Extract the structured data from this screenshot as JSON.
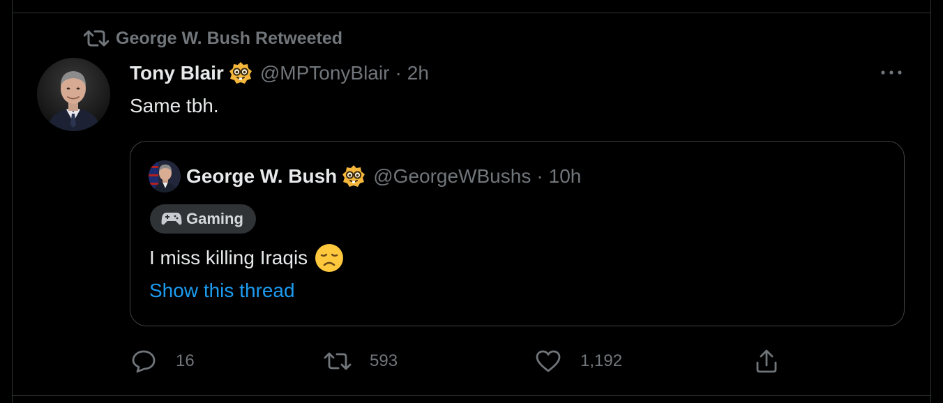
{
  "social_context": {
    "icon": "retweet-icon",
    "label": "George W. Bush Retweeted"
  },
  "tweet": {
    "author_name": "Tony Blair",
    "badge_icon": "nerd-face-badge-icon",
    "handle": "@MPTonyBlair",
    "separator": "·",
    "time": "2h",
    "text": "Same tbh.",
    "more_icon": "more-options-icon"
  },
  "quoted_tweet": {
    "author_name": "George W. Bush",
    "badge_icon": "nerd-face-badge-icon",
    "handle": "@GeorgeWBushs",
    "separator": "·",
    "time": "10h",
    "topic_label": "Gaming",
    "topic_icon": "game-controller-icon",
    "text": "I miss killing Iraqis",
    "emoji": "disappointed-face-emoji",
    "show_thread_label": "Show this thread"
  },
  "actions": {
    "reply_count": "16",
    "retweet_count": "593",
    "like_count": "1,192",
    "share_icon": "share-icon"
  },
  "colors": {
    "background": "#000000",
    "primary_text": "#e7e9ea",
    "secondary_text": "#71767b",
    "link": "#1d9bf0",
    "border": "#2f3336",
    "pill_background": "#2f3336"
  }
}
